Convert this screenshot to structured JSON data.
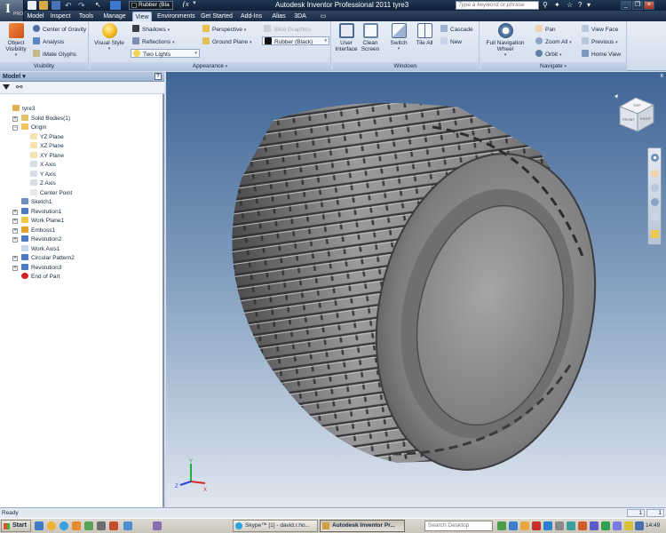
{
  "app": {
    "logo_letter": "I",
    "logo_sub": "PRO",
    "title": "Autodesk Inventor Professional 2011    tyre3",
    "material": "Rubber (Bla",
    "search_placeholder": "Type a keyword or phrase"
  },
  "ribbon_tabs": [
    "Model",
    "Inspect",
    "Tools",
    "Manage",
    "View",
    "Environments",
    "Get Started",
    "Add-Ins",
    "Alias",
    "3DA"
  ],
  "active_tab": "View",
  "ribbon": {
    "visibility": {
      "label": "Visibility",
      "object_visibility": "Object Visibility",
      "center_of_gravity": "Center of Gravity",
      "analysis": "Analysis",
      "imate_glyphs": "iMate Glyphs"
    },
    "appearance": {
      "label": "Appearance",
      "visual_style": "Visual Style",
      "shadows": "Shadows",
      "reflections": "Reflections",
      "lights": "Two Lights",
      "perspective": "Perspective",
      "ground_plane": "Ground Plane",
      "slice_graphics": "Slice Graphics",
      "material": "Rubber (Black)"
    },
    "windows": {
      "label": "Windows",
      "user_interface": "User Interface",
      "clean_screen": "Clean Screen",
      "switch": "Switch",
      "tile_all": "Tile All",
      "cascade": "Cascade",
      "new": "New"
    },
    "navigate": {
      "label": "Navigate",
      "full_navigation_wheel": "Full Navigation Wheel",
      "pan": "Pan",
      "zoom_all": "Zoom All",
      "orbit": "Orbit",
      "view_face": "View Face",
      "previous": "Previous",
      "home_view": "Home View"
    }
  },
  "browser": {
    "title": "Model",
    "help": "?",
    "tree": [
      {
        "label": "tyre3",
        "expander": ""
      },
      {
        "label": "Solid Bodies(1)",
        "expander": "+"
      },
      {
        "label": "Origin",
        "expander": "−"
      },
      {
        "label": "YZ Plane",
        "expander": ""
      },
      {
        "label": "XZ Plane",
        "expander": ""
      },
      {
        "label": "XY Plane",
        "expander": ""
      },
      {
        "label": "X Axis",
        "expander": ""
      },
      {
        "label": "Y Axis",
        "expander": ""
      },
      {
        "label": "Z Axis",
        "expander": ""
      },
      {
        "label": "Center Point",
        "expander": ""
      },
      {
        "label": "Sketch1",
        "expander": ""
      },
      {
        "label": "Revolution1",
        "expander": "+"
      },
      {
        "label": "Work Plane1",
        "expander": "+"
      },
      {
        "label": "Emboss1",
        "expander": "+"
      },
      {
        "label": "Revolution2",
        "expander": "+"
      },
      {
        "label": "Work Axis1",
        "expander": ""
      },
      {
        "label": "Circular Pattern2",
        "expander": "+"
      },
      {
        "label": "Revolution3",
        "expander": "+"
      },
      {
        "label": "End of Part",
        "expander": ""
      }
    ]
  },
  "viewcube": {
    "top": "TOP",
    "front": "FRONT",
    "right": "RIGHT"
  },
  "triad": {
    "x": "X",
    "y": "Y",
    "z": "Z"
  },
  "viewport_close": "x",
  "statusbar": {
    "text": "Ready",
    "count_a": "1",
    "count_b": "1"
  },
  "taskbar": {
    "start": "Start",
    "buttons": [
      "Skype™ [1] - david.r.ho...",
      "Autodesk Inventor Pr..."
    ],
    "active_button": "Autodesk Inventor Pr...",
    "search_placeholder": "Search Desktop",
    "clock": "14:49"
  },
  "colors": {
    "title_bar": "#1a2d46",
    "viewport_top": "#3f6595",
    "viewport_bottom": "#dfe6ef",
    "tyre": "#8b8b8d"
  }
}
